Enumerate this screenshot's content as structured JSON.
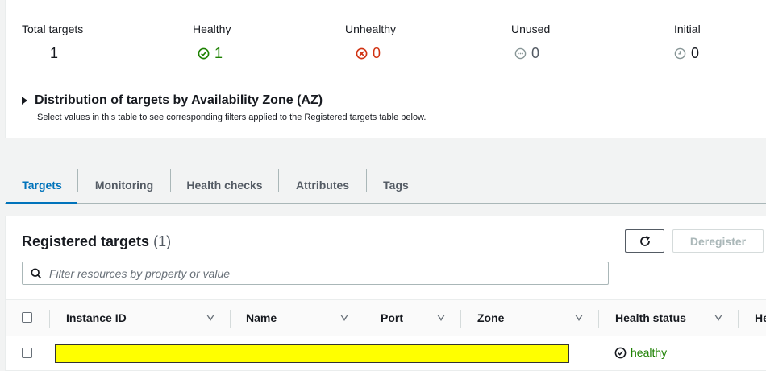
{
  "summary": {
    "stats": [
      {
        "label": "Total targets",
        "value": "1"
      },
      {
        "label": "Healthy",
        "value": "1",
        "icon": "check-circle-icon",
        "color": "#1d8102"
      },
      {
        "label": "Unhealthy",
        "value": "0",
        "icon": "x-circle-icon",
        "color": "#d13212"
      },
      {
        "label": "Unused",
        "value": "0",
        "icon": "ellipsis-circle-icon",
        "color": "#545b64"
      },
      {
        "label": "Initial",
        "value": "0",
        "icon": "clock-icon",
        "color": "#545b64"
      }
    ],
    "az_title": "Distribution of targets by Availability Zone (AZ)",
    "az_subtitle": "Select values in this table to see corresponding filters applied to the Registered targets table below."
  },
  "tabs": [
    {
      "label": "Targets",
      "active": true
    },
    {
      "label": "Monitoring"
    },
    {
      "label": "Health checks"
    },
    {
      "label": "Attributes"
    },
    {
      "label": "Tags"
    }
  ],
  "registered": {
    "title": "Registered targets",
    "count": "(1)",
    "refresh_icon": "refresh-icon",
    "deregister_label": "Deregister",
    "search_placeholder": "Filter resources by property or value",
    "columns": [
      "Instance ID",
      "Name",
      "Port",
      "Zone",
      "Health status",
      "He"
    ],
    "rows": [
      {
        "health_status": "healthy",
        "redacted": true
      }
    ]
  },
  "colors": {
    "accent": "#0073bb",
    "healthy": "#1d8102",
    "unhealthy": "#d13212",
    "redaction": "#ffff00"
  }
}
